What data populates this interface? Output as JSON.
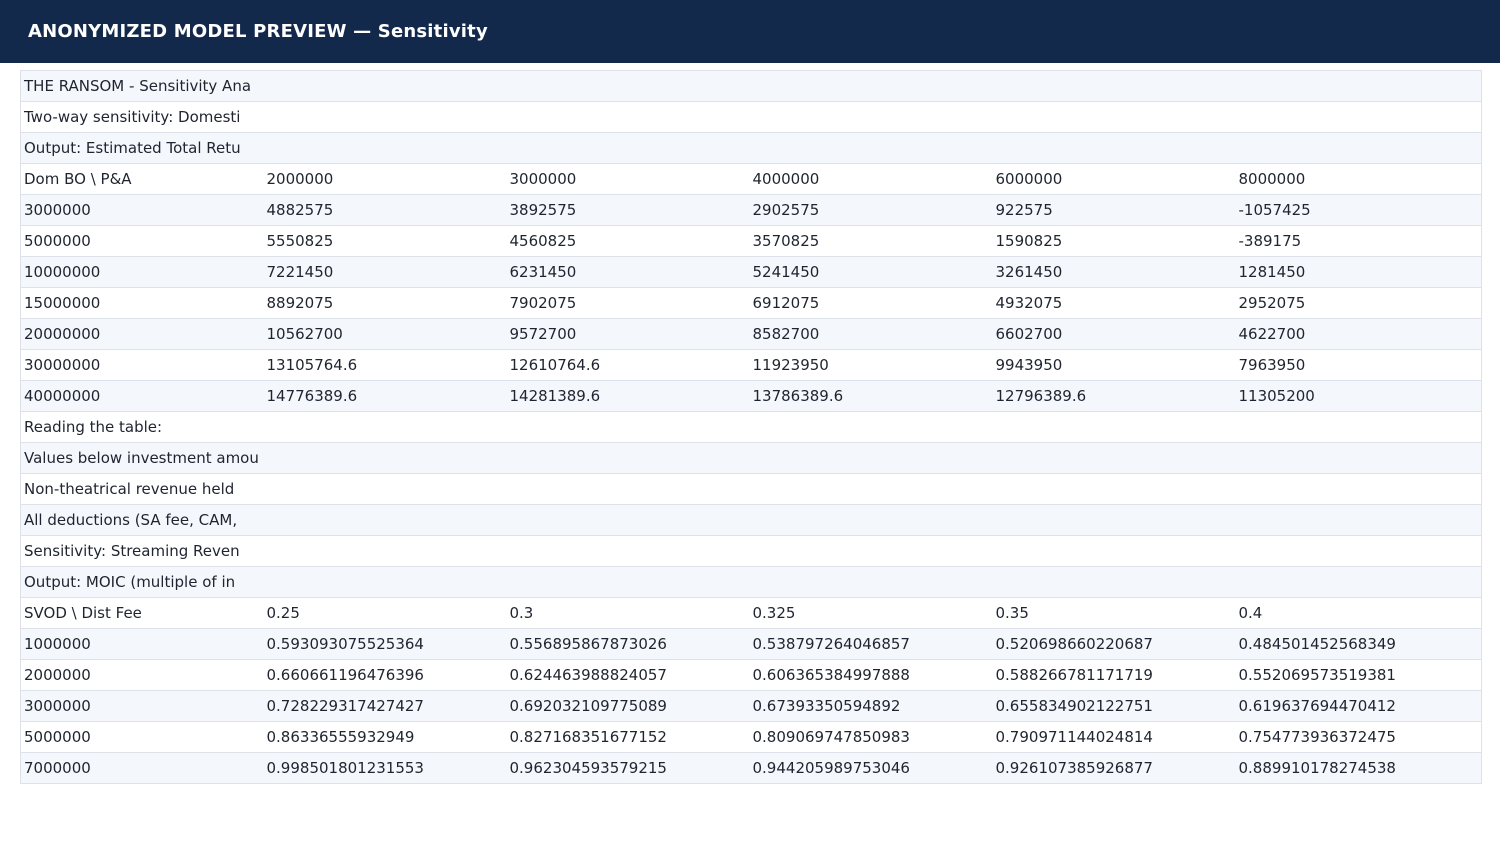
{
  "header": {
    "title": "ANONYMIZED MODEL PREVIEW — Sensitivity"
  },
  "rows": [
    [
      "THE RANSOM - Sensitivity Ana",
      "",
      "",
      "",
      "",
      ""
    ],
    [
      "Two-way sensitivity: Domesti",
      "",
      "",
      "",
      "",
      ""
    ],
    [
      "Output: Estimated Total Retu",
      "",
      "",
      "",
      "",
      ""
    ],
    [
      "Dom BO \\ P&A",
      "2000000",
      "3000000",
      "4000000",
      "6000000",
      "8000000"
    ],
    [
      "3000000",
      "4882575",
      "3892575",
      "2902575",
      "922575",
      "-1057425"
    ],
    [
      "5000000",
      "5550825",
      "4560825",
      "3570825",
      "1590825",
      "-389175"
    ],
    [
      "10000000",
      "7221450",
      "6231450",
      "5241450",
      "3261450",
      "1281450"
    ],
    [
      "15000000",
      "8892075",
      "7902075",
      "6912075",
      "4932075",
      "2952075"
    ],
    [
      "20000000",
      "10562700",
      "9572700",
      "8582700",
      "6602700",
      "4622700"
    ],
    [
      "30000000",
      "13105764.6",
      "12610764.6",
      "11923950",
      "9943950",
      "7963950"
    ],
    [
      "40000000",
      "14776389.6",
      "14281389.6",
      "13786389.6",
      "12796389.6",
      "11305200"
    ],
    [
      "Reading the table:",
      "",
      "",
      "",
      "",
      ""
    ],
    [
      "Values below investment amou",
      "",
      "",
      "",
      "",
      ""
    ],
    [
      "Non-theatrical revenue held",
      "",
      "",
      "",
      "",
      ""
    ],
    [
      "All deductions (SA fee, CAM,",
      "",
      "",
      "",
      "",
      ""
    ],
    [
      "Sensitivity: Streaming Reven",
      "",
      "",
      "",
      "",
      ""
    ],
    [
      "Output: MOIC (multiple of in",
      "",
      "",
      "",
      "",
      ""
    ],
    [
      "SVOD \\ Dist Fee",
      "0.25",
      "0.3",
      "0.325",
      "0.35",
      "0.4"
    ],
    [
      "1000000",
      "0.593093075525364",
      "0.556895867873026",
      "0.538797264046857",
      "0.520698660220687",
      "0.484501452568349"
    ],
    [
      "2000000",
      "0.660661196476396",
      "0.624463988824057",
      "0.606365384997888",
      "0.588266781171719",
      "0.552069573519381"
    ],
    [
      "3000000",
      "0.728229317427427",
      "0.692032109775089",
      "0.67393350594892",
      "0.655834902122751",
      "0.619637694470412"
    ],
    [
      "5000000",
      "0.86336555932949",
      "0.827168351677152",
      "0.809069747850983",
      "0.790971144024814",
      "0.754773936372475"
    ],
    [
      "7000000",
      "0.998501801231553",
      "0.962304593579215",
      "0.944205989753046",
      "0.926107385926877",
      "0.889910178274538"
    ]
  ]
}
